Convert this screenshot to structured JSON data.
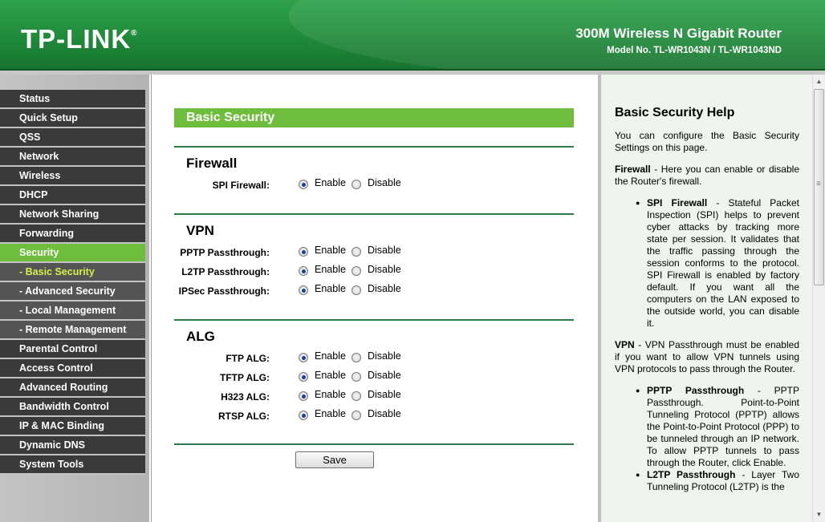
{
  "header": {
    "logo": "TP-LINK",
    "logo_reg": "®",
    "product": "300M Wireless N Gigabit Router",
    "model": "Model No. TL-WR1043N / TL-WR1043ND"
  },
  "sidebar": {
    "items": [
      {
        "label": "Status"
      },
      {
        "label": "Quick Setup"
      },
      {
        "label": "QSS"
      },
      {
        "label": "Network"
      },
      {
        "label": "Wireless"
      },
      {
        "label": "DHCP"
      },
      {
        "label": "Network Sharing"
      },
      {
        "label": "Forwarding"
      },
      {
        "label": "Security"
      },
      {
        "label": "- Basic Security"
      },
      {
        "label": "- Advanced Security"
      },
      {
        "label": "- Local Management"
      },
      {
        "label": "- Remote Management"
      },
      {
        "label": "Parental Control"
      },
      {
        "label": "Access Control"
      },
      {
        "label": "Advanced Routing"
      },
      {
        "label": "Bandwidth Control"
      },
      {
        "label": "IP & MAC Binding"
      },
      {
        "label": "Dynamic DNS"
      },
      {
        "label": "System Tools"
      }
    ]
  },
  "main": {
    "title": "Basic Security",
    "enable_label": "Enable",
    "disable_label": "Disable",
    "firewall": {
      "title": "Firewall",
      "rows": [
        {
          "label": "SPI Firewall:",
          "value": "Enable"
        }
      ]
    },
    "vpn": {
      "title": "VPN",
      "rows": [
        {
          "label": "PPTP Passthrough:",
          "value": "Enable"
        },
        {
          "label": "L2TP Passthrough:",
          "value": "Enable"
        },
        {
          "label": "IPSec Passthrough:",
          "value": "Enable"
        }
      ]
    },
    "alg": {
      "title": "ALG",
      "rows": [
        {
          "label": "FTP ALG:",
          "value": "Enable"
        },
        {
          "label": "TFTP ALG:",
          "value": "Enable"
        },
        {
          "label": "H323 ALG:",
          "value": "Enable"
        },
        {
          "label": "RTSP ALG:",
          "value": "Enable"
        }
      ]
    },
    "save_label": "Save"
  },
  "help": {
    "title": "Basic Security Help",
    "intro": "You can configure the Basic Security Settings on this page.",
    "firewall_term": "Firewall",
    "firewall_text": " - Here you can enable or disable the Router's firewall.",
    "spi_term": "SPI Firewall",
    "spi_text": " - Stateful Packet Inspection (SPI) helps to prevent cyber attacks by tracking more state per session. It validates that the traffic passing through the session conforms to the protocol. SPI Firewall is enabled by factory default. If you want all the computers on the LAN exposed to the outside world, you can disable it.",
    "vpn_term": "VPN",
    "vpn_text": " - VPN Passthrough must be enabled if you want to allow VPN tunnels using VPN protocols to pass through the Router.",
    "pptp_term": "PPTP Passthrough",
    "pptp_text": " - PPTP Passthrough. Point-to-Point Tunneling Protocol (PPTP) allows the Point-to-Point Protocol (PPP) to be tunneled through an IP network. To allow PPTP tunnels to pass through the Router, click Enable.",
    "l2tp_term": "L2TP Passthrough",
    "l2tp_text": " - Layer Two Tunneling Protocol (L2TP) is the"
  }
}
